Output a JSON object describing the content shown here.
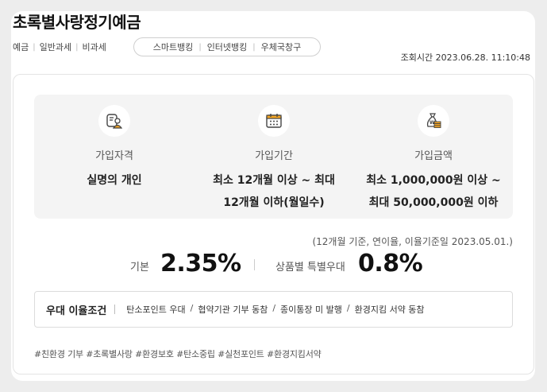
{
  "product": {
    "title": "초록별사랑정기예금"
  },
  "tax_tags": [
    "예금",
    "일반과세",
    "비과세"
  ],
  "channels": [
    "스마트뱅킹",
    "인터넷뱅킹",
    "우체국창구"
  ],
  "inquiry_time": "조회시간 2023.06.28. 11:10:48",
  "info": {
    "eligibility": {
      "label": "가입자격",
      "value": "실명의 개인",
      "icon": "user-document-icon"
    },
    "period": {
      "label": "가입기간",
      "line1": "최소 12개월 이상 ~ 최대",
      "line2": "12개월 이하(월일수)",
      "icon": "calendar-icon"
    },
    "amount": {
      "label": "가입금액",
      "line1": "최소 1,000,000원 이상 ~",
      "line2": "최대 50,000,000원 이하",
      "icon": "money-bag-icon"
    }
  },
  "rates": {
    "note": "(12개월 기준, 연이율, 이율기준일 2023.05.01.)",
    "basic_label": "기본",
    "basic_value": "2.35%",
    "pref_label": "상품별 특별우대",
    "pref_value": "0.8%"
  },
  "conditions": {
    "title": "우대 이율조건",
    "items": [
      "탄소포인트 우대",
      "협약기관 기부 동참",
      "종이통장 미 발행",
      "환경지킴 서약 동참"
    ]
  },
  "hashtags": "#친환경 기부 #초록별사랑 #환경보호 #탄소중립 #실천포인트 #환경지킴서약",
  "colors": {
    "accent": "#f5a623",
    "panel": "#f4f4f4",
    "background": "#ededed"
  }
}
